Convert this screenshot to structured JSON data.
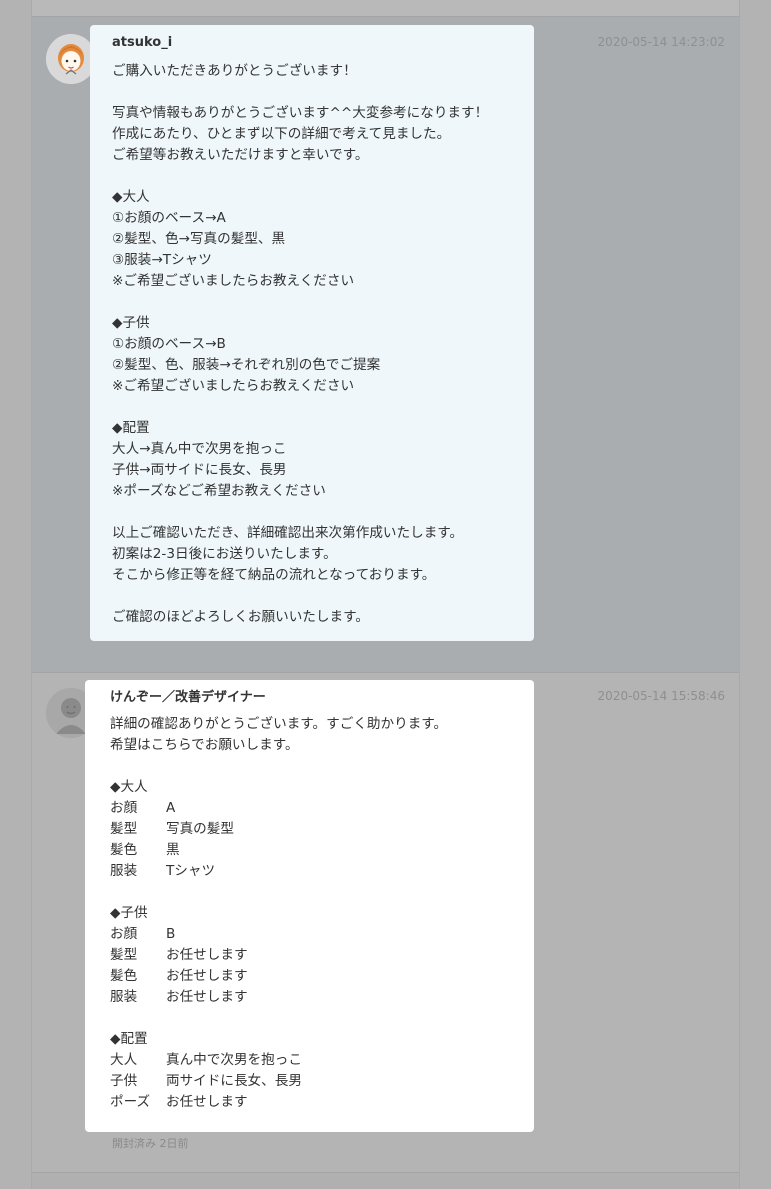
{
  "messages": [
    {
      "sender": "atsuko_i",
      "timestamp": "2020-05-14 14:23:02",
      "lines": [
        "ご購入いただきありがとうございます！",
        "",
        "写真や情報もありがとうございます^^大変参考になります！",
        "作成にあたり、ひとまず以下の詳細で考えて見ました。",
        "ご希望等お教えいただけますと幸いです。",
        "",
        "◆大人",
        "①お顔のベース→A",
        "②髪型、色→写真の髪型、黒",
        "③服装→Tシャツ",
        "※ご希望ございましたらお教えください",
        "",
        "◆子供",
        "①お顔のベース→B",
        "②髪型、色、服装→それぞれ別の色でご提案",
        "※ご希望ございましたらお教えください",
        "",
        "◆配置",
        "大人→真ん中で次男を抱っこ",
        "子供→両サイドに長女、長男",
        "※ポーズなどご希望お教えください",
        "",
        "以上ご確認いただき、詳細確認出来次第作成いたします。",
        "初案は2-3日後にお送りいたします。",
        "そこから修正等を経て納品の流れとなっております。",
        "",
        "ご確認のほどよろしくお願いいたします。"
      ]
    },
    {
      "sender": "けんぞー／改善デザイナー",
      "timestamp": "2020-05-14 15:58:46",
      "intro": [
        "詳細の確認ありがとうございます。すごく助かります。",
        "希望はこちらでお願いします。"
      ],
      "sections": [
        {
          "title": "◆大人",
          "rows": [
            {
              "key": "お顔",
              "value": "A"
            },
            {
              "key": "髪型",
              "value": "写真の髪型"
            },
            {
              "key": "髪色",
              "value": "黒"
            },
            {
              "key": "服装",
              "value": "Tシャツ"
            }
          ]
        },
        {
          "title": "◆子供",
          "rows": [
            {
              "key": "お顔",
              "value": "B"
            },
            {
              "key": "髪型",
              "value": "お任せします"
            },
            {
              "key": "髪色",
              "value": "お任せします"
            },
            {
              "key": "服装",
              "value": "お任せします"
            }
          ]
        },
        {
          "title": "◆配置",
          "rows": [
            {
              "key": "大人",
              "value": "真ん中で次男を抱っこ"
            },
            {
              "key": "子供",
              "value": "両サイドに長女、長男"
            },
            {
              "key": "ポーズ",
              "value": "お任せします"
            }
          ]
        }
      ],
      "read_status": "開封済み 2日前"
    }
  ],
  "colors": {
    "page_background": "#b3b3b3",
    "received_bubble": "#eff7fa",
    "sent_bubble": "#ffffff",
    "timestamp_text": "#8f8f8f"
  },
  "icons": {
    "avatar_one": "orange-haired-person-avatar-icon",
    "avatar_two": "default-user-avatar-icon"
  }
}
